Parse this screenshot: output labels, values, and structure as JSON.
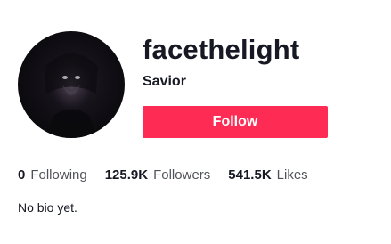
{
  "profile": {
    "username": "facethelight",
    "nickname": "Savior",
    "follow_label": "Follow",
    "bio": "No bio yet.",
    "avatar_icon": "avatar-image",
    "accent_color": "#fe2c55"
  },
  "stats": [
    {
      "value": "0",
      "label": "Following"
    },
    {
      "value": "125.9K",
      "label": "Followers"
    },
    {
      "value": "541.5K",
      "label": "Likes"
    }
  ]
}
